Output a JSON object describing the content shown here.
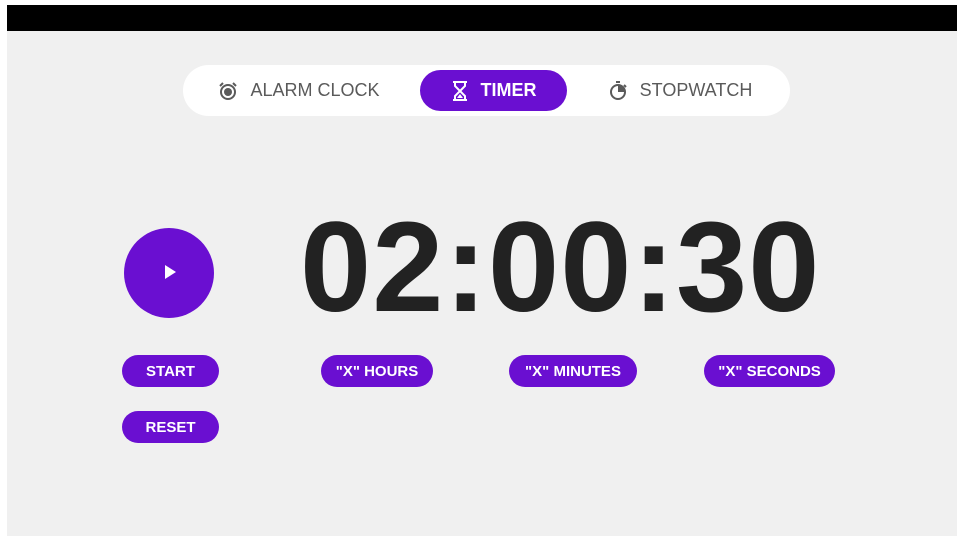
{
  "status_bar": {
    "left_text": "",
    "right_text": ""
  },
  "tabs": [
    {
      "label": "ALARM CLOCK",
      "icon": "alarm-clock-icon",
      "selected": false
    },
    {
      "label": "TIMER",
      "icon": "hourglass-icon",
      "selected": true
    },
    {
      "label": "STOPWATCH",
      "icon": "stopwatch-icon",
      "selected": false
    }
  ],
  "timer": {
    "display": "02:00:30"
  },
  "controls": {
    "start_label": "START",
    "reset_label": "RESET",
    "hours_label": "\"X\" HOURS",
    "minutes_label": "\"X\" MINUTES",
    "seconds_label": "\"X\" SECONDS"
  },
  "colors": {
    "accent": "#6a0fd1",
    "background": "#f0f0f0",
    "status_bar": "#000000",
    "text_dark": "#222222"
  }
}
